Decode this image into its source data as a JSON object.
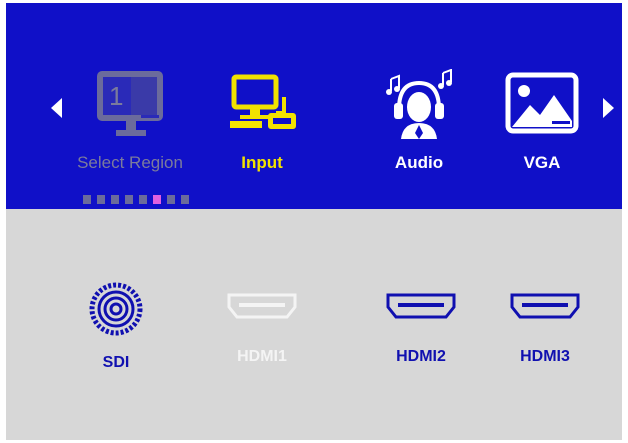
{
  "menu": {
    "items": [
      {
        "label": "Select Region",
        "icon": "select-region-icon",
        "state": "disabled",
        "region_number": "1"
      },
      {
        "label": "Input",
        "icon": "input-icon",
        "state": "selected"
      },
      {
        "label": "Audio",
        "icon": "audio-icon",
        "state": "normal"
      },
      {
        "label": "VGA",
        "icon": "vga-icon",
        "state": "normal"
      }
    ],
    "page_indicator": {
      "count": 8,
      "active_index": 5
    }
  },
  "sources": [
    {
      "label": "SDI",
      "icon": "sdi-connector-icon",
      "state": "normal"
    },
    {
      "label": "HDMI1",
      "icon": "hdmi-port-icon",
      "state": "active"
    },
    {
      "label": "HDMI2",
      "icon": "hdmi-port-icon",
      "state": "normal"
    },
    {
      "label": "HDMI3",
      "icon": "hdmi-port-icon",
      "state": "normal"
    }
  ],
  "colors": {
    "menu_background": "#1010c8",
    "content_background": "#d7d7d7",
    "selected_text": "#f2e200",
    "disabled_text": "#7b7b9c",
    "normal_menu_text": "#ffffff",
    "source_text": "#1010b0",
    "active_source_text": "#f4f4f4"
  }
}
